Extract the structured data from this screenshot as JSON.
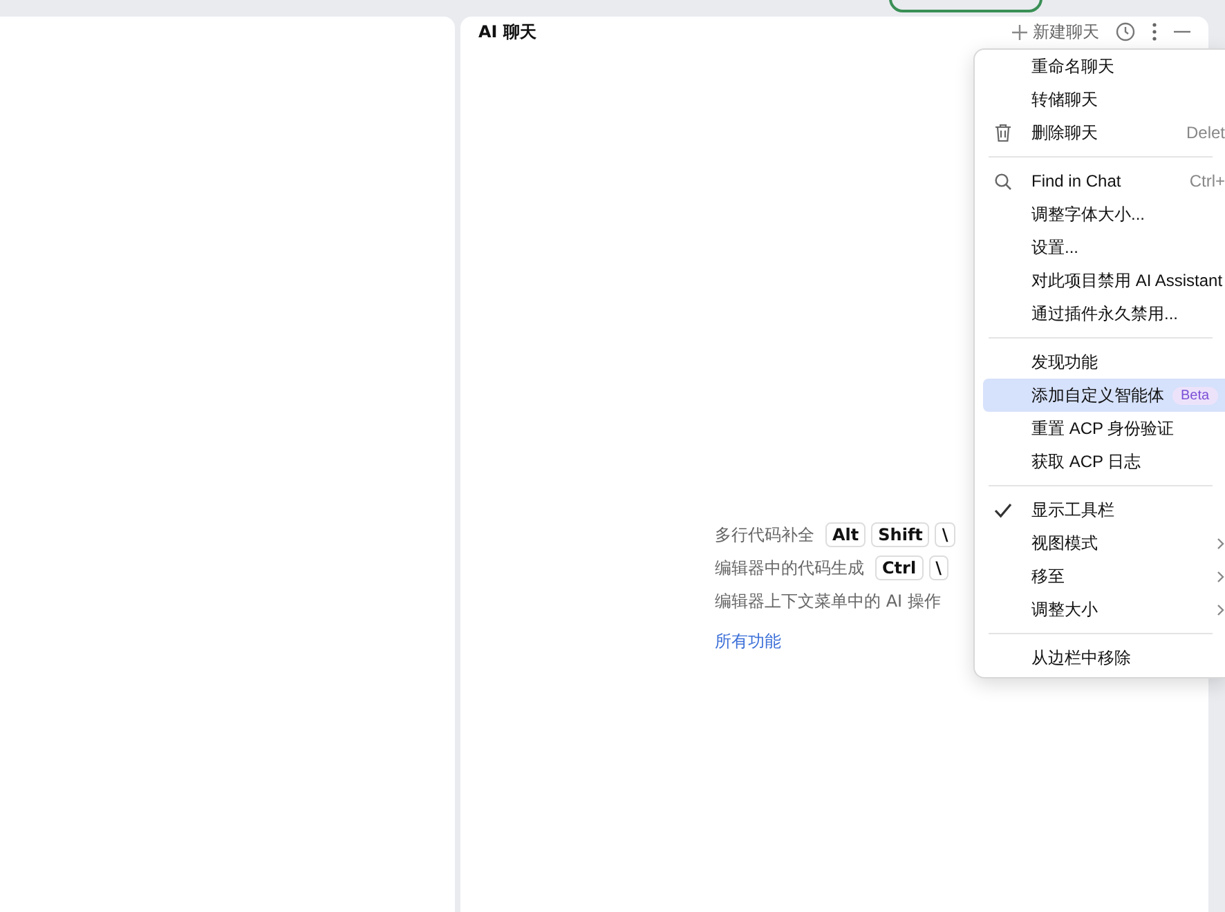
{
  "chat_panel": {
    "title": "AI 聊天",
    "new_chat": "新建聊天"
  },
  "features": [
    {
      "label": "多行代码补全",
      "keys": [
        "Alt",
        "Shift",
        "\\"
      ]
    },
    {
      "label": "编辑器中的代码生成",
      "keys": [
        "Ctrl",
        "\\"
      ]
    },
    {
      "label": "编辑器上下文菜单中的 AI 操作"
    }
  ],
  "all_features_link": "所有功能",
  "menu": {
    "groups": [
      [
        {
          "label": "重命名聊天",
          "selected": false
        },
        {
          "label": "转储聊天",
          "selected": false
        },
        {
          "label": "删除聊天",
          "shortcut": "Delet",
          "selected": false
        }
      ],
      [
        {
          "label": "Find in Chat",
          "shortcut": "Ctrl+",
          "selected": false
        },
        {
          "label": "调整字体大小...",
          "selected": false
        },
        {
          "label": "设置...",
          "selected": false
        },
        {
          "label": "对此项目禁用 AI Assistant",
          "selected": false
        },
        {
          "label": "通过插件永久禁用...",
          "selected": false
        }
      ],
      [
        {
          "label": "发现功能",
          "selected": false
        },
        {
          "label": "添加自定义智能体",
          "badge": "Beta",
          "selected": true
        },
        {
          "label": "重置 ACP 身份验证",
          "selected": false
        },
        {
          "label": "获取 ACP 日志",
          "selected": false
        }
      ],
      [
        {
          "label": "显示工具栏",
          "checked": true,
          "selected": false
        },
        {
          "label": "视图模式",
          "checked": false,
          "submenu": true,
          "selected": false
        },
        {
          "label": "移至",
          "checked": false,
          "submenu": true,
          "selected": false
        },
        {
          "label": "调整大小",
          "checked": false,
          "submenu": true,
          "selected": false
        }
      ],
      [
        {
          "label": "从边栏中移除",
          "selected": false
        }
      ]
    ]
  }
}
